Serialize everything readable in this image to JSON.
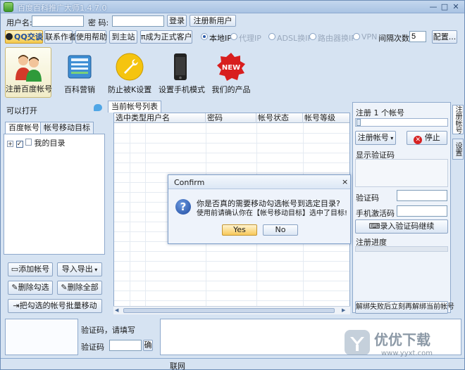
{
  "window": {
    "title": "百度百科推广大师1.4.7.0"
  },
  "login": {
    "username_label": "用户名:",
    "username_value": "",
    "password_label": "密  码:",
    "password_value": "",
    "login_button": "登录",
    "register_button": "注册新用户"
  },
  "toolbar": {
    "qq_button": "QQ交谈",
    "contact_author": "联系作者",
    "help": "使用帮助",
    "home": "到主站",
    "become_customer": "成为正式客户",
    "proxies": [
      {
        "label": "本地IP",
        "selected": true,
        "enabled": true
      },
      {
        "label": "代理IP",
        "selected": false,
        "enabled": false
      },
      {
        "label": "ADSL换IP",
        "selected": false,
        "enabled": false
      },
      {
        "label": "路由器换IP",
        "selected": false,
        "enabled": false
      },
      {
        "label": "VPN",
        "selected": false,
        "enabled": false
      }
    ],
    "interval_label": "间隔次数",
    "interval_value": "5",
    "config_button": "配置..."
  },
  "modules": [
    {
      "label": "注册百度帐号",
      "icon": "user-couple-icon",
      "selected": true
    },
    {
      "label": "百科营销",
      "icon": "book-icon",
      "selected": false
    },
    {
      "label": "防止被K设置",
      "icon": "wrench-icon",
      "selected": false
    },
    {
      "label": "设置手机模式",
      "icon": "phone-icon",
      "selected": false
    },
    {
      "label": "我们的产品",
      "icon": "new-badge-icon",
      "selected": false
    }
  ],
  "left": {
    "can_open": "可以打开",
    "tabs": [
      "百度帐号",
      "帐号移动目标"
    ],
    "tree_root": "我的目录",
    "buttons": {
      "add_account": "添加帐号",
      "import_export": "导入导出",
      "delete_checked": "删除勾选",
      "delete_all": "删除全部",
      "move_checked": "把勾选的帐号批量移动"
    }
  },
  "center": {
    "tab": "当前帐号列表",
    "columns": [
      "选中",
      "类型",
      "用户名",
      "密码",
      "帐号状态",
      "帐号等级"
    ]
  },
  "right": {
    "register_count": "注册 1 个帐号",
    "register_button": "注册帐号",
    "stop_button": "停止",
    "show_captcha": "显示验证码",
    "captcha_label": "验证码",
    "phone_captcha_label": "手机激活码",
    "enter_captcha_button": "录入验证码继续",
    "progress_label": "注册进度",
    "unbind_button": "解绑失败后立刻再解绑当前帐号",
    "side_tabs": [
      "注册帐号",
      "设置"
    ]
  },
  "bottom": {
    "captcha_prompt": "验证码，请填写",
    "captcha_label": "验证码",
    "confirm_button": "确"
  },
  "status": {
    "network": "联网"
  },
  "dialog": {
    "title": "Confirm",
    "line1": "你是否真的需要移动勾选帐号到选定目录?",
    "line2": "使用前请确认你在【帐号移动目标】选中了目标!",
    "yes": "Yes",
    "no": "No"
  },
  "watermark": {
    "text": "优优下载",
    "url": "www.yyxt.com"
  }
}
